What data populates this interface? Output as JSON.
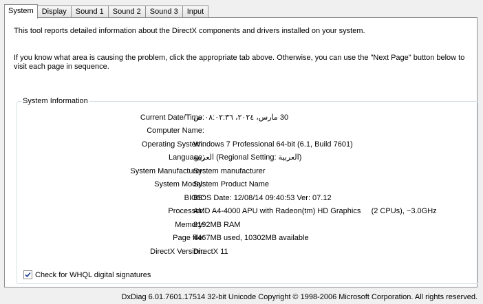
{
  "tabs": [
    {
      "label": "System",
      "active": true
    },
    {
      "label": "Display",
      "active": false
    },
    {
      "label": "Sound 1",
      "active": false
    },
    {
      "label": "Sound 2",
      "active": false
    },
    {
      "label": "Sound 3",
      "active": false
    },
    {
      "label": "Input",
      "active": false
    }
  ],
  "intro": {
    "line1": "This tool reports detailed information about the DirectX components and drivers installed on your system.",
    "line2": "If you know what area is causing the problem, click the appropriate tab above.  Otherwise, you can use the \"Next Page\" button below to visit each page in sequence."
  },
  "system_info": {
    "group_title": "System Information",
    "rows": [
      {
        "label": "Current Date/Time:",
        "value": "30 مارس، ٢٠٢٤، ٠٨:٠٢:٣٦ ص",
        "rtl": true
      },
      {
        "label": "Computer Name:",
        "value": ""
      },
      {
        "label": "Operating System:",
        "value": "Windows 7 Professional 64-bit (6.1, Build 7601)"
      },
      {
        "label": "Language:",
        "value": "العربية (Regional Setting: العربية)"
      },
      {
        "label": "System Manufacturer:",
        "value": "System manufacturer"
      },
      {
        "label": "System Model:",
        "value": "System Product Name"
      },
      {
        "label": "BIOS:",
        "value": "BIOS Date: 12/08/14 09:40:53 Ver: 07.12"
      },
      {
        "label": "Processor:",
        "value": "AMD A4-4000 APU with Radeon(tm) HD Graphics     (2 CPUs), ~3.0GHz"
      },
      {
        "label": "Memory:",
        "value": "8192MB RAM"
      },
      {
        "label": "Page file:",
        "value": "4467MB used, 10302MB available"
      },
      {
        "label": "DirectX Version:",
        "value": "DirectX 11"
      }
    ]
  },
  "whql": {
    "label": "Check for WHQL digital signatures",
    "checked": true
  },
  "footer": "DxDiag 6.01.7601.17514 32-bit Unicode  Copyright © 1998-2006 Microsoft Corporation.  All rights reserved."
}
